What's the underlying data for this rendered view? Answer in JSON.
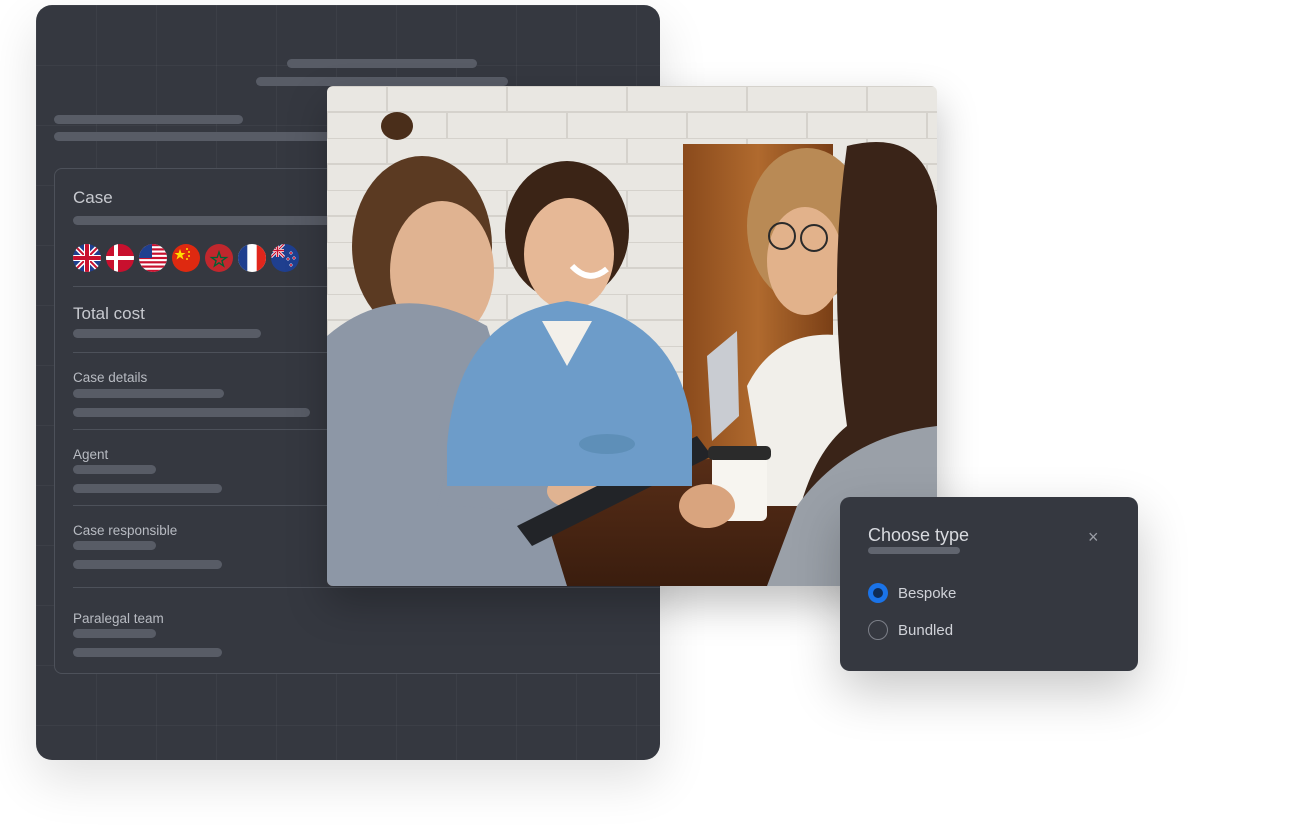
{
  "case_panel": {
    "case_label": "Case",
    "flags": [
      "uk-flag-icon",
      "denmark-flag-icon",
      "usa-flag-icon",
      "china-flag-icon",
      "morocco-flag-icon",
      "france-flag-icon",
      "new-zealand-flag-icon"
    ],
    "total_cost_label": "Total cost",
    "case_details_label": "Case details",
    "agent_label": "Agent",
    "case_responsible_label": "Case responsible",
    "paralegal_team_label": "Paralegal team"
  },
  "dialog": {
    "title": "Choose type",
    "close_icon": "×",
    "options": [
      {
        "label": "Bespoke",
        "selected": true
      },
      {
        "label": "Bundled",
        "selected": false
      }
    ]
  },
  "colors": {
    "panel_bg": "#353840",
    "radio_selected": "#1a73e8",
    "placeholder_bar": "#585c66"
  }
}
